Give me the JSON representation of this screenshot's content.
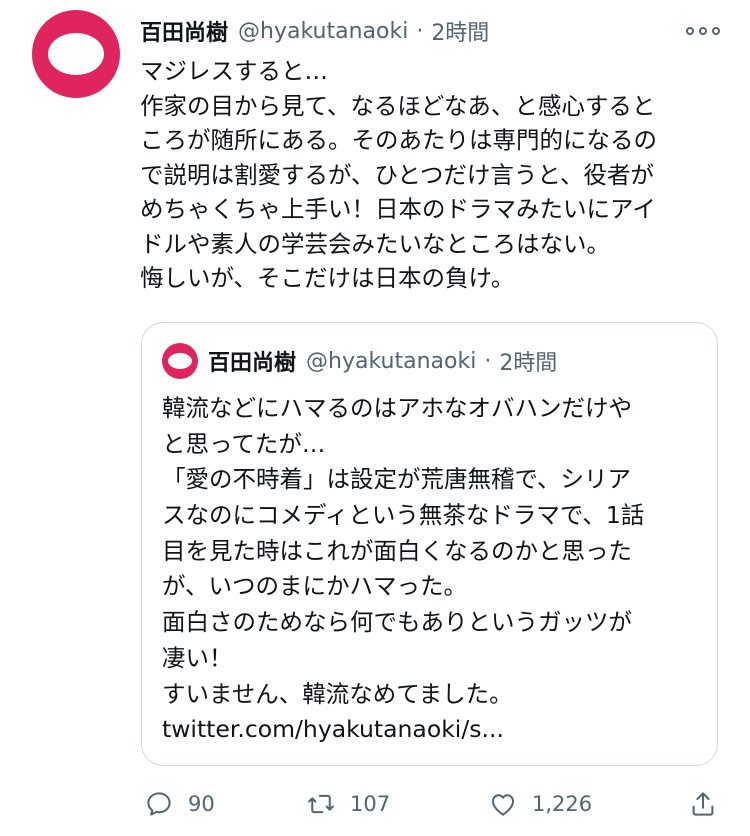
{
  "tweet": {
    "author_name": "百田尚樹",
    "handle": "@hyakutanaoki",
    "separator": "·",
    "time": "2時間",
    "text_lines": [
      "マジレスすると…",
      "作家の目から見て、なるほどなあ、と感心すると",
      "ころが随所にある。そのあたりは専門的になるの",
      "で説明は割愛するが、ひとつだけ言うと、役者が",
      "めちゃくちゃ上手い！日本のドラマみたいにアイ",
      "ドルや素人の学芸会みたいなところはない。",
      "悔しいが、そこだけは日本の負け。"
    ]
  },
  "quoted_tweet": {
    "author_name": "百田尚樹",
    "handle": "@hyakutanaoki",
    "separator": "·",
    "time": "2時間",
    "text_lines": [
      "韓流などにハマるのはアホなオバハンだけや",
      "と思ってたが…",
      "「愛の不時着」は設定が荒唐無稽で、シリア",
      "スなのにコメディという無茶なドラマで、1話",
      "目を見た時はこれが面白くなるのかと思った",
      "が、いつのまにかハマった。",
      "面白さのためなら何でもありというガッツが",
      "凄い！",
      "すいません、韓流なめてました。",
      "twitter.com/hyakutanaoki/s..."
    ]
  },
  "actions": {
    "reply_count": "90",
    "retweet_count": "107",
    "like_count": "1,226"
  },
  "colors": {
    "avatar": "#e0245e",
    "secondary_text": "#536471",
    "border": "#cfd9de"
  },
  "icons": [
    "more-icon",
    "reply-icon",
    "retweet-icon",
    "like-icon",
    "share-icon"
  ]
}
